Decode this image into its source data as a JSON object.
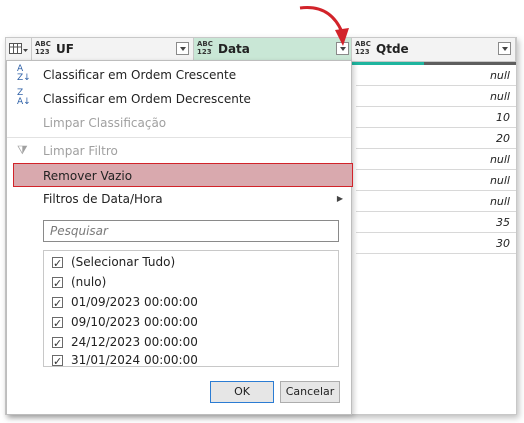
{
  "columns": [
    {
      "type_top": "ABC",
      "type_bot": "123",
      "name": "UF"
    },
    {
      "type_top": "ABC",
      "type_bot": "123",
      "name": "Data"
    },
    {
      "type_top": "ABC",
      "type_bot": "123",
      "name": "Qtde"
    }
  ],
  "qtde_values": [
    "null",
    "null",
    "10",
    "20",
    "null",
    "null",
    "null",
    "35",
    "30"
  ],
  "menu": {
    "sort_asc": "Classificar em Ordem Crescente",
    "sort_desc": "Classificar em Ordem Decrescente",
    "clear_sort": "Limpar Classificação",
    "clear_filter": "Limpar Filtro",
    "remove_empty": "Remover Vazio",
    "date_filters": "Filtros de Data/Hora",
    "search_placeholder": "Pesquisar",
    "items": [
      "(Selecionar Tudo)",
      "(nulo)",
      "01/09/2023 00:00:00",
      "09/10/2023 00:00:00",
      "24/12/2023 00:00:00",
      "31/01/2024 00:00:00"
    ],
    "ok": "OK",
    "cancel": "Cancelar"
  },
  "colors": {
    "selected_header": "#c9e7d6",
    "highlight": "#d9a9ae",
    "highlight_border": "#d2232a",
    "arrow": "#d2232a"
  }
}
